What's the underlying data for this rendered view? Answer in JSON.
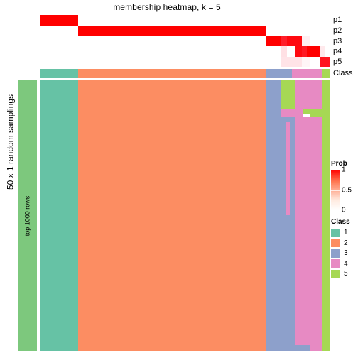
{
  "title": "membership heatmap, k = 5",
  "axis": {
    "y_title": "50 x 1 random samplings",
    "row_annotation_label": "top 1000 rows"
  },
  "prob_rows": [
    {
      "label": "p1"
    },
    {
      "label": "p2"
    },
    {
      "label": "p3"
    },
    {
      "label": "p4"
    },
    {
      "label": "p5"
    }
  ],
  "class_annotation": {
    "label": "Class"
  },
  "legends": {
    "prob": {
      "title": "Prob",
      "ticks": [
        "1",
        "0.5",
        "0"
      ],
      "low_color": "#ffffff",
      "high_color": "#ff0000"
    },
    "class": {
      "title": "Class",
      "items": [
        {
          "label": "1",
          "color": "#66c2a5"
        },
        {
          "label": "2",
          "color": "#fc8d62"
        },
        {
          "label": "3",
          "color": "#8da0cb"
        },
        {
          "label": "4",
          "color": "#e78ac3"
        },
        {
          "label": "5",
          "color": "#a6d854"
        }
      ]
    }
  },
  "chart_data": {
    "type": "heatmap",
    "title": "membership heatmap, k = 5",
    "xlabel": "",
    "ylabel": "50 x 1 random samplings",
    "grid": false,
    "legend_position": "right",
    "n_clusters": 5,
    "class_palette": [
      "#66c2a5",
      "#fc8d62",
      "#8da0cb",
      "#e78ac3",
      "#a6d854"
    ],
    "prob_scale": {
      "min": 0,
      "max": 1,
      "colors": [
        "#ffffff",
        "#ff0000"
      ]
    },
    "row_annotation_color": "#7dc87d",
    "prob_matrix_rows": [
      {
        "name": "p1",
        "cells": [
          {
            "x0": 0.0,
            "x1": 0.131,
            "value": 1.0
          },
          {
            "x0": 0.131,
            "x1": 1.0,
            "value": 0.0
          }
        ]
      },
      {
        "name": "p2",
        "cells": [
          {
            "x0": 0.0,
            "x1": 0.131,
            "value": 0.0
          },
          {
            "x0": 0.131,
            "x1": 0.779,
            "value": 1.0
          },
          {
            "x0": 0.779,
            "x1": 1.0,
            "value": 0.0
          }
        ]
      },
      {
        "name": "p3",
        "cells": [
          {
            "x0": 0.0,
            "x1": 0.779,
            "value": 0.0
          },
          {
            "x0": 0.779,
            "x1": 0.828,
            "value": 1.0
          },
          {
            "x0": 0.828,
            "x1": 0.851,
            "value": 0.82
          },
          {
            "x0": 0.851,
            "x1": 0.902,
            "value": 0.93
          },
          {
            "x0": 0.902,
            "x1": 0.93,
            "value": 0.05
          },
          {
            "x0": 0.93,
            "x1": 1.0,
            "value": 0.0
          }
        ]
      },
      {
        "name": "p4",
        "cells": [
          {
            "x0": 0.0,
            "x1": 0.828,
            "value": 0.0
          },
          {
            "x0": 0.828,
            "x1": 0.851,
            "value": 0.1
          },
          {
            "x0": 0.851,
            "x1": 0.879,
            "value": 0.0
          },
          {
            "x0": 0.879,
            "x1": 0.902,
            "value": 0.93
          },
          {
            "x0": 0.902,
            "x1": 0.918,
            "value": 0.85
          },
          {
            "x0": 0.918,
            "x1": 0.93,
            "value": 1.0
          },
          {
            "x0": 0.93,
            "x1": 0.965,
            "value": 1.0
          },
          {
            "x0": 0.965,
            "x1": 0.983,
            "value": 0.07
          },
          {
            "x0": 0.983,
            "x1": 1.0,
            "value": 0.0
          }
        ]
      },
      {
        "name": "p5",
        "cells": [
          {
            "x0": 0.0,
            "x1": 0.828,
            "value": 0.0
          },
          {
            "x0": 0.828,
            "x1": 0.902,
            "value": 0.09
          },
          {
            "x0": 0.902,
            "x1": 0.93,
            "value": 0.03
          },
          {
            "x0": 0.93,
            "x1": 0.965,
            "value": 0.0
          },
          {
            "x0": 0.965,
            "x1": 1.0,
            "value": 0.87
          }
        ]
      }
    ],
    "class_bar": [
      {
        "x0": 0.0,
        "x1": 0.131,
        "class": 1
      },
      {
        "x0": 0.131,
        "x1": 0.779,
        "class": 2
      },
      {
        "x0": 0.779,
        "x1": 0.867,
        "class": 3
      },
      {
        "x0": 0.867,
        "x1": 0.973,
        "class": 4
      },
      {
        "x0": 0.973,
        "x1": 1.0,
        "class": 5
      }
    ],
    "membership_blocks": [
      {
        "x0": 0.0,
        "x1": 0.131,
        "y0": 0.0,
        "y1": 1.0,
        "class": 1
      },
      {
        "x0": 0.131,
        "x1": 0.779,
        "y0": 0.0,
        "y1": 1.0,
        "class": 2
      },
      {
        "x0": 0.779,
        "x1": 0.828,
        "y0": 0.0,
        "y1": 1.0,
        "class": 3
      },
      {
        "x0": 0.828,
        "x1": 0.879,
        "y0": 0.0,
        "y1": 0.105,
        "class": 5
      },
      {
        "x0": 0.828,
        "x1": 0.879,
        "y0": 0.105,
        "y1": 0.137,
        "class": 4
      },
      {
        "x0": 0.828,
        "x1": 0.879,
        "y0": 0.137,
        "y1": 1.0,
        "class": 3
      },
      {
        "x0": 0.845,
        "x1": 0.86,
        "y0": 0.155,
        "y1": 0.5,
        "class": 4
      },
      {
        "x0": 0.879,
        "x1": 0.973,
        "y0": 0.0,
        "y1": 0.105,
        "class": 4
      },
      {
        "x0": 0.879,
        "x1": 0.93,
        "y0": 0.105,
        "y1": 0.125,
        "class": 4
      },
      {
        "x0": 0.879,
        "x1": 0.905,
        "y0": 0.105,
        "y1": 0.137,
        "class": 4
      },
      {
        "x0": 0.905,
        "x1": 0.93,
        "y0": 0.105,
        "y1": 0.125,
        "class": 5
      },
      {
        "x0": 0.93,
        "x1": 0.973,
        "y0": 0.105,
        "y1": 0.137,
        "class": 5
      },
      {
        "x0": 0.879,
        "x1": 0.973,
        "y0": 0.137,
        "y1": 1.0,
        "class": 4
      },
      {
        "x0": 0.93,
        "x1": 0.973,
        "y0": 0.105,
        "y1": 0.137,
        "class": 5
      },
      {
        "x0": 0.973,
        "x1": 1.0,
        "y0": 0.0,
        "y1": 1.0,
        "class": 5
      },
      {
        "x0": 0.973,
        "x1": 1.0,
        "y0": 0.105,
        "y1": 0.137,
        "class": 5
      },
      {
        "x0": 0.879,
        "x1": 0.93,
        "y0": 0.98,
        "y1": 1.0,
        "class": 3
      },
      {
        "x0": 0.93,
        "x1": 0.973,
        "y0": 0.965,
        "y1": 1.0,
        "class": 4
      }
    ]
  }
}
